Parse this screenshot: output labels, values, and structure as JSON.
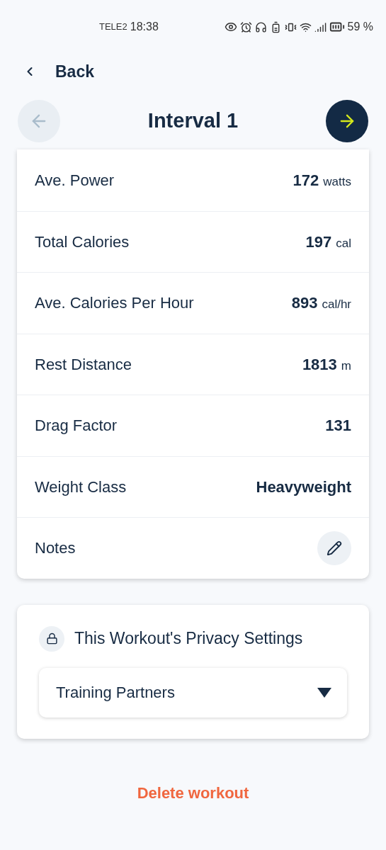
{
  "status_bar": {
    "carrier": "TELE2",
    "time": "18:38",
    "battery": "59 %"
  },
  "nav": {
    "back": "Back"
  },
  "header": {
    "title": "Interval 1",
    "prev_disabled": true,
    "next_disabled": false
  },
  "stats": [
    {
      "kind": "stat",
      "label": "Ave. Power",
      "value": "172",
      "unit": "watts"
    },
    {
      "kind": "stat",
      "label": "Total Calories",
      "value": "197",
      "unit": "cal"
    },
    {
      "kind": "stat",
      "label": "Ave. Calories Per Hour",
      "value": "893",
      "unit": "cal/hr"
    },
    {
      "kind": "stat",
      "label": "Rest Distance",
      "value": "1813",
      "unit": "m"
    },
    {
      "kind": "stat",
      "label": "Drag Factor",
      "value": "131"
    },
    {
      "kind": "stat",
      "label": "Weight Class",
      "value": "Heavyweight"
    },
    {
      "kind": "edit",
      "label": "Notes"
    }
  ],
  "privacy": {
    "title": "This Workout's Privacy Settings",
    "value": "Training Partners"
  },
  "delete": "Delete workout"
}
